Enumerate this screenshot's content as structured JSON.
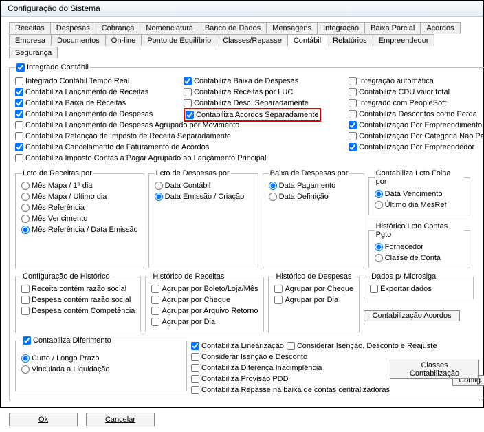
{
  "title": "Configuração do Sistema",
  "tabs": [
    "Receitas",
    "Despesas",
    "Cobrança",
    "Nomenclatura",
    "Banco de Dados",
    "Mensagens",
    "Integração",
    "Baixa Parcial",
    "Acordos",
    "Empresa",
    "Documentos",
    "On-line",
    "Ponto de Equilíbrio",
    "Classes/Repasse",
    "Contábil",
    "Relatórios",
    "Empreendedor",
    "Segurança"
  ],
  "main_legend": "Integrado Contábil",
  "checks_col1": [
    {
      "l": "Integrado Contábil Tempo Real",
      "c": false
    },
    {
      "l": "Contabiliza Lançamento de Receitas",
      "c": true
    },
    {
      "l": "Contabiliza Baixa de Receitas",
      "c": true
    },
    {
      "l": "Contabiliza Lançamento de Despesas",
      "c": true
    },
    {
      "l": "Contabiliza Lançamento de Despesas Agrupado por Movimento",
      "c": false
    },
    {
      "l": "Contabiliza Retenção de Imposto de Receita Separadamente",
      "c": false
    },
    {
      "l": "Contabiliza Cancelamento de Faturamento de Acordos",
      "c": true
    },
    {
      "l": "Contabiliza Imposto Contas a Pagar Agrupado ao Lançamento Principal",
      "c": false
    }
  ],
  "checks_col2": [
    {
      "l": "Contabiliza Baixa de Despesas",
      "c": true
    },
    {
      "l": "Contabiliza Receitas por LUC",
      "c": false
    },
    {
      "l": "Contabiliza Desc. Separadamente",
      "c": false
    },
    {
      "l": "Contabiliza Acordos Separadamente",
      "c": true
    }
  ],
  "checks_col3": [
    {
      "l": "Integração automática",
      "c": false
    },
    {
      "l": "Contabiliza CDU valor total",
      "c": false
    },
    {
      "l": "Integrado com PeopleSoft",
      "c": false
    },
    {
      "l": "Contabiliza Descontos como Perda",
      "c": false
    },
    {
      "l": "Contabilização Por Empreendimento",
      "c": true
    },
    {
      "l": "Contabilização Por Categoria Não Padrão",
      "c": false
    },
    {
      "l": "Contabilização Por Empreendedor",
      "c": true
    }
  ],
  "config_btn": "Config.",
  "lcto_rec_legend": "Lcto de Receitas por",
  "lcto_rec": [
    "Mês Mapa / 1º dia",
    "Mês Mapa / Ultimo dia",
    "Mês Referência",
    "Mês Vencimento",
    "Mês Referência / Data Emissão"
  ],
  "lcto_desp_legend": "Lcto de Despesas por",
  "lcto_desp": [
    "Data Contábil",
    "Data Emissão / Criação"
  ],
  "baixa_desp_legend": "Baixa de Despesas por",
  "baixa_desp": [
    "Data Pagamento",
    "Data Definição"
  ],
  "contab_folha_legend": "Contabiliza Lcto Folha por",
  "contab_folha": [
    "Data Vencimento",
    "Último dia MesRef"
  ],
  "hist_pgto_legend": "Histórico Lcto Contas Pgto",
  "hist_pgto": [
    "Fornecedor",
    "Classe de Conta"
  ],
  "config_hist_legend": "Configuração de Histórico",
  "config_hist": [
    "Receita contém razão social",
    "Despesa contém razão social",
    "Despesa contém Competência"
  ],
  "hist_rec_legend": "Histórico de Receitas",
  "hist_rec": [
    "Agrupar por Boleto/Loja/Mês",
    "Agrupar por Cheque",
    "Agrupar por Arquivo Retorno",
    "Agrupar por Dia"
  ],
  "hist_desp_legend": "Histórico de Despesas",
  "hist_desp": [
    "Agrupar por Cheque",
    "Agrupar por Dia"
  ],
  "microsiga_legend": "Dados p/ Microsiga",
  "microsiga": "Exportar dados",
  "contab_acordos_btn": "Contabilização Acordos",
  "dif_legend": "Contabiliza Diferimento",
  "dif": [
    "Curto / Longo Prazo",
    "Vinculada a Liquidação"
  ],
  "right_checks": [
    {
      "l": "Contabiliza Linearização",
      "c": true
    },
    {
      "l": "Considerar Isenção, Desconto e Reajuste",
      "c": false
    },
    {
      "l": "Considerar Isenção e Desconto",
      "c": false
    },
    {
      "l": "Contabiliza Diferença Inadimplência",
      "c": false
    },
    {
      "l": "Contabiliza Provisão PDD",
      "c": false
    },
    {
      "l": "Contabiliza Repasse na baixa de contas centralizadoras",
      "c": false
    }
  ],
  "classes_btn": "Classes Contabilização",
  "ok": "Ok",
  "cancel": "Cancelar"
}
